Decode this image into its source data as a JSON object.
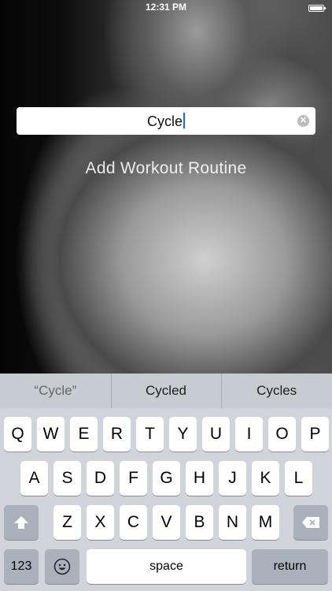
{
  "status_bar": {
    "time": "12:31 PM"
  },
  "search": {
    "value": "Cycle",
    "clear_icon": "clear-icon"
  },
  "heading": "Add Workout Routine",
  "suggestions": [
    "“Cycle”",
    "Cycled",
    "Cycles"
  ],
  "keyboard": {
    "row1": [
      "Q",
      "W",
      "E",
      "R",
      "T",
      "Y",
      "U",
      "I",
      "O",
      "P"
    ],
    "row2": [
      "A",
      "S",
      "D",
      "F",
      "G",
      "H",
      "J",
      "K",
      "L"
    ],
    "row3": [
      "Z",
      "X",
      "C",
      "V",
      "B",
      "N",
      "M"
    ],
    "shift_icon": "shift-icon",
    "delete_icon": "delete-icon",
    "numbers_label": "123",
    "emoji_icon": "emoji-icon",
    "space_label": "space",
    "return_label": "return"
  }
}
